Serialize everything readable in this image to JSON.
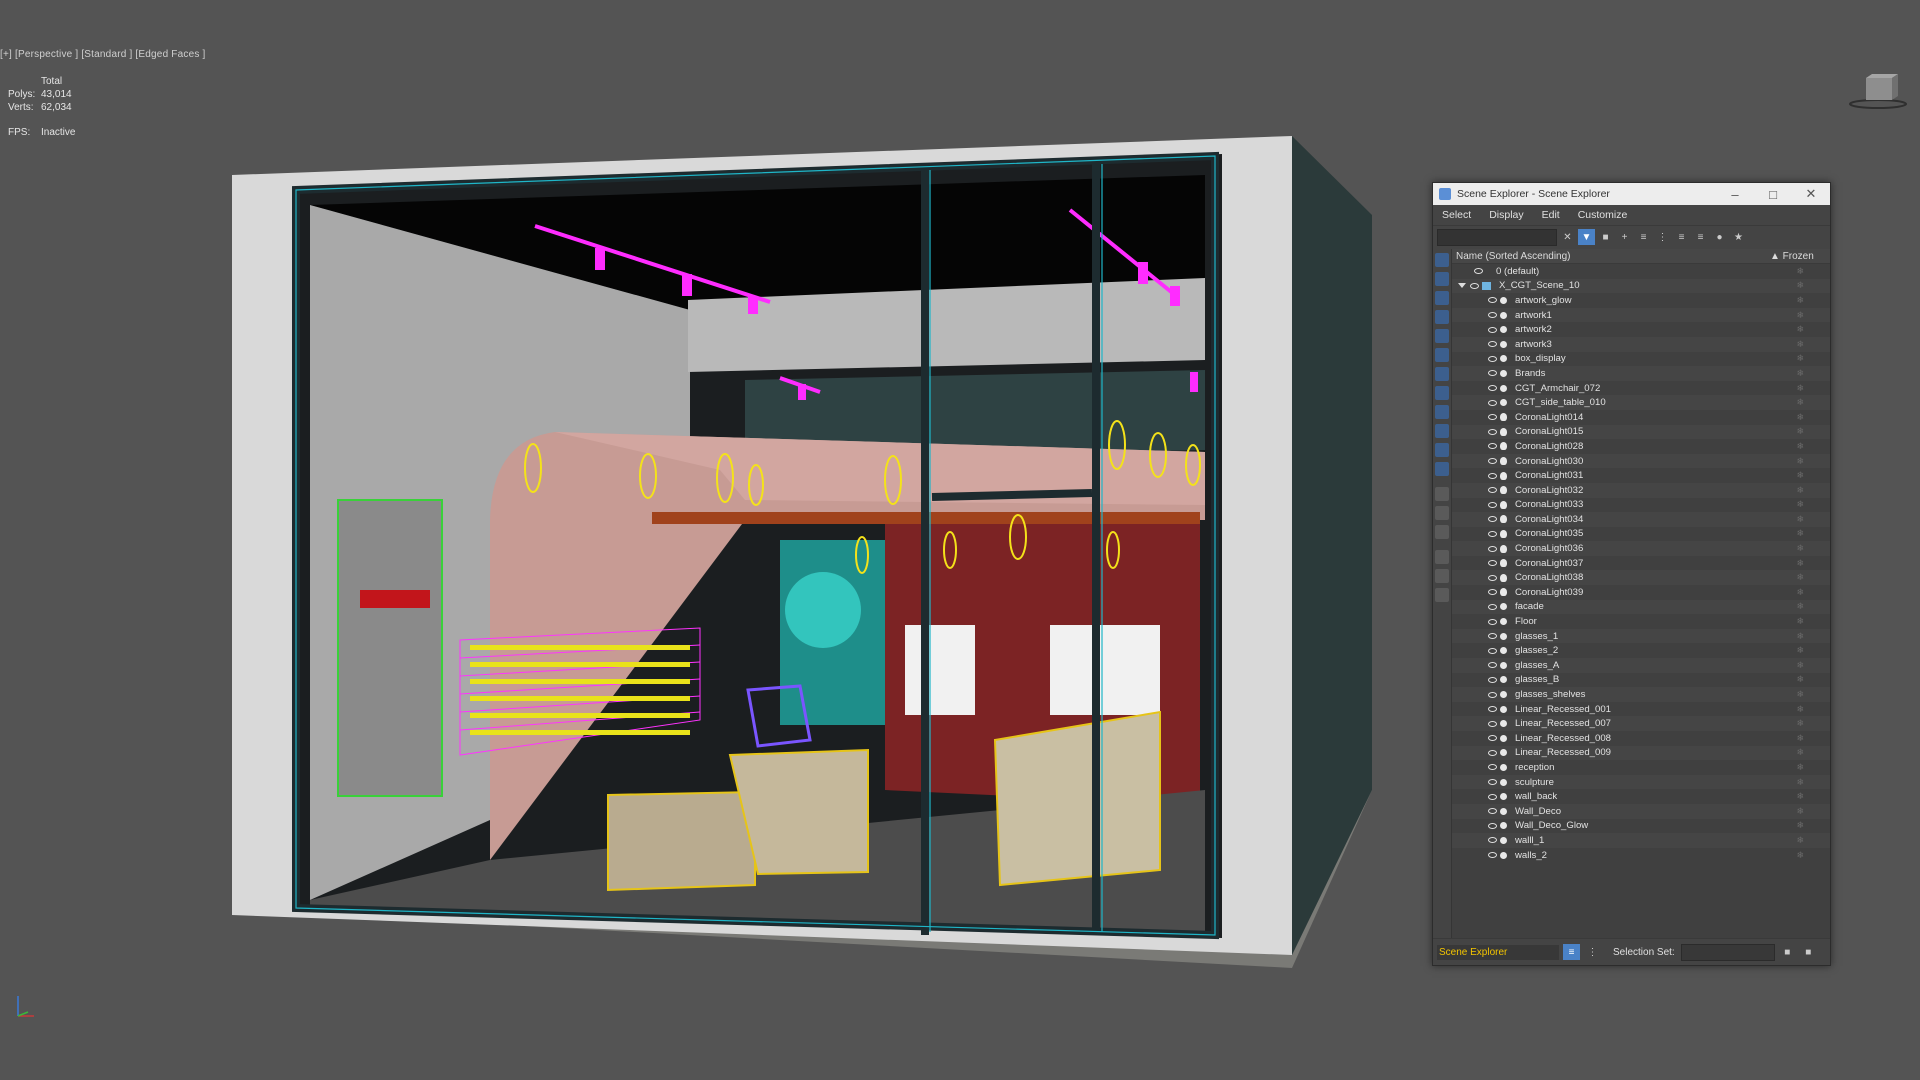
{
  "viewport": {
    "label": "[+] [Perspective ] [Standard ] [Edged Faces ]",
    "stats": {
      "total_label": "Total",
      "polys_label": "Polys:",
      "polys_value": "43,014",
      "verts_label": "Verts:",
      "verts_value": "62,034",
      "fps_label": "FPS:",
      "fps_value": "Inactive"
    }
  },
  "scene_explorer": {
    "title": "Scene Explorer - Scene Explorer",
    "menu": [
      "Select",
      "Display",
      "Edit",
      "Customize"
    ],
    "header": {
      "name": "Name (Sorted Ascending)",
      "frozen": "▲ Frozen"
    },
    "default_layer": "0 (default)",
    "scene_layer": "X_CGT_Scene_10",
    "items": [
      "artwork_glow",
      "artwork1",
      "artwork2",
      "artwork3",
      "box_display",
      "Brands",
      "CGT_Armchair_072",
      "CGT_side_table_010",
      "CoronaLight014",
      "CoronaLight015",
      "CoronaLight028",
      "CoronaLight030",
      "CoronaLight031",
      "CoronaLight032",
      "CoronaLight033",
      "CoronaLight034",
      "CoronaLight035",
      "CoronaLight036",
      "CoronaLight037",
      "CoronaLight038",
      "CoronaLight039",
      "facade",
      "Floor",
      "glasses_1",
      "glasses_2",
      "glasses_A",
      "glasses_B",
      "glasses_shelves",
      "Linear_Recessed_001",
      "Linear_Recessed_007",
      "Linear_Recessed_008",
      "Linear_Recessed_009",
      "reception",
      "sculpture",
      "wall_back",
      "Wall_Deco",
      "Wall_Deco_Glow",
      "walll_1",
      "walls_2"
    ],
    "footer": {
      "explorer_name": "Scene Explorer",
      "selection_set_label": "Selection Set:"
    }
  }
}
